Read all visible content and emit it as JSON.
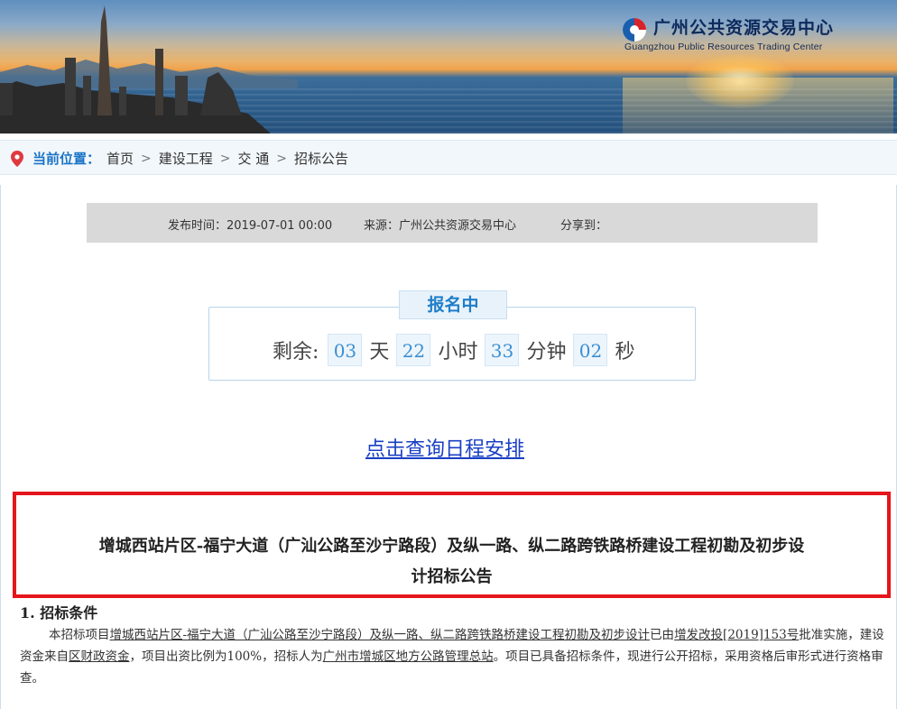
{
  "header": {
    "org_name_cn": "广州公共资源交易中心",
    "org_name_en": "Guangzhou Public Resources Trading Center"
  },
  "breadcrumb": {
    "label": "当前位置：",
    "items": [
      "首页",
      "建设工程",
      "交 通",
      "招标公告"
    ]
  },
  "meta": {
    "publish_time": "发布时间：2019-07-01 00:00",
    "source": "来源：广州公共资源交易中心",
    "share": "分享到："
  },
  "registration": {
    "status": "报名中",
    "remaining_label": "剩余:",
    "days": "03",
    "days_unit": "天",
    "hours": "22",
    "hours_unit": "小时",
    "minutes": "33",
    "minutes_unit": "分钟",
    "seconds": "02",
    "seconds_unit": "秒"
  },
  "schedule_link": "点击查询日程安排",
  "announcement": {
    "title_line1": "增城西站片区-福宁大道（广汕公路至沙宁路段）及纵一路、纵二路跨铁路桥建设工程初勘及初步设",
    "title_line2": "计招标公告",
    "section1_heading": "1. 招标条件",
    "p1_a": "本招标项目",
    "p1_project": "增城西站片区-福宁大道（广汕公路至沙宁路段）及纵一路、纵二路跨铁路桥建设工程初勘及初步设计",
    "p1_b": "已由",
    "p1_approval": "增发改投[2019]153号",
    "p1_c": "批准实施，建设资金来自",
    "p1_fund": "区财政资金",
    "p1_d": "，项目出资比例为100%，招标人为",
    "p1_tenderer": "广州市增城区地方公路管理总站",
    "p1_e": "。项目已具备招标条件，现进行公开招标，采用资格后审形式进行资格审查。"
  },
  "colors": {
    "accent_blue": "#1a73c8",
    "highlight_red": "#e5151c",
    "link_blue": "#1a3fc4"
  }
}
